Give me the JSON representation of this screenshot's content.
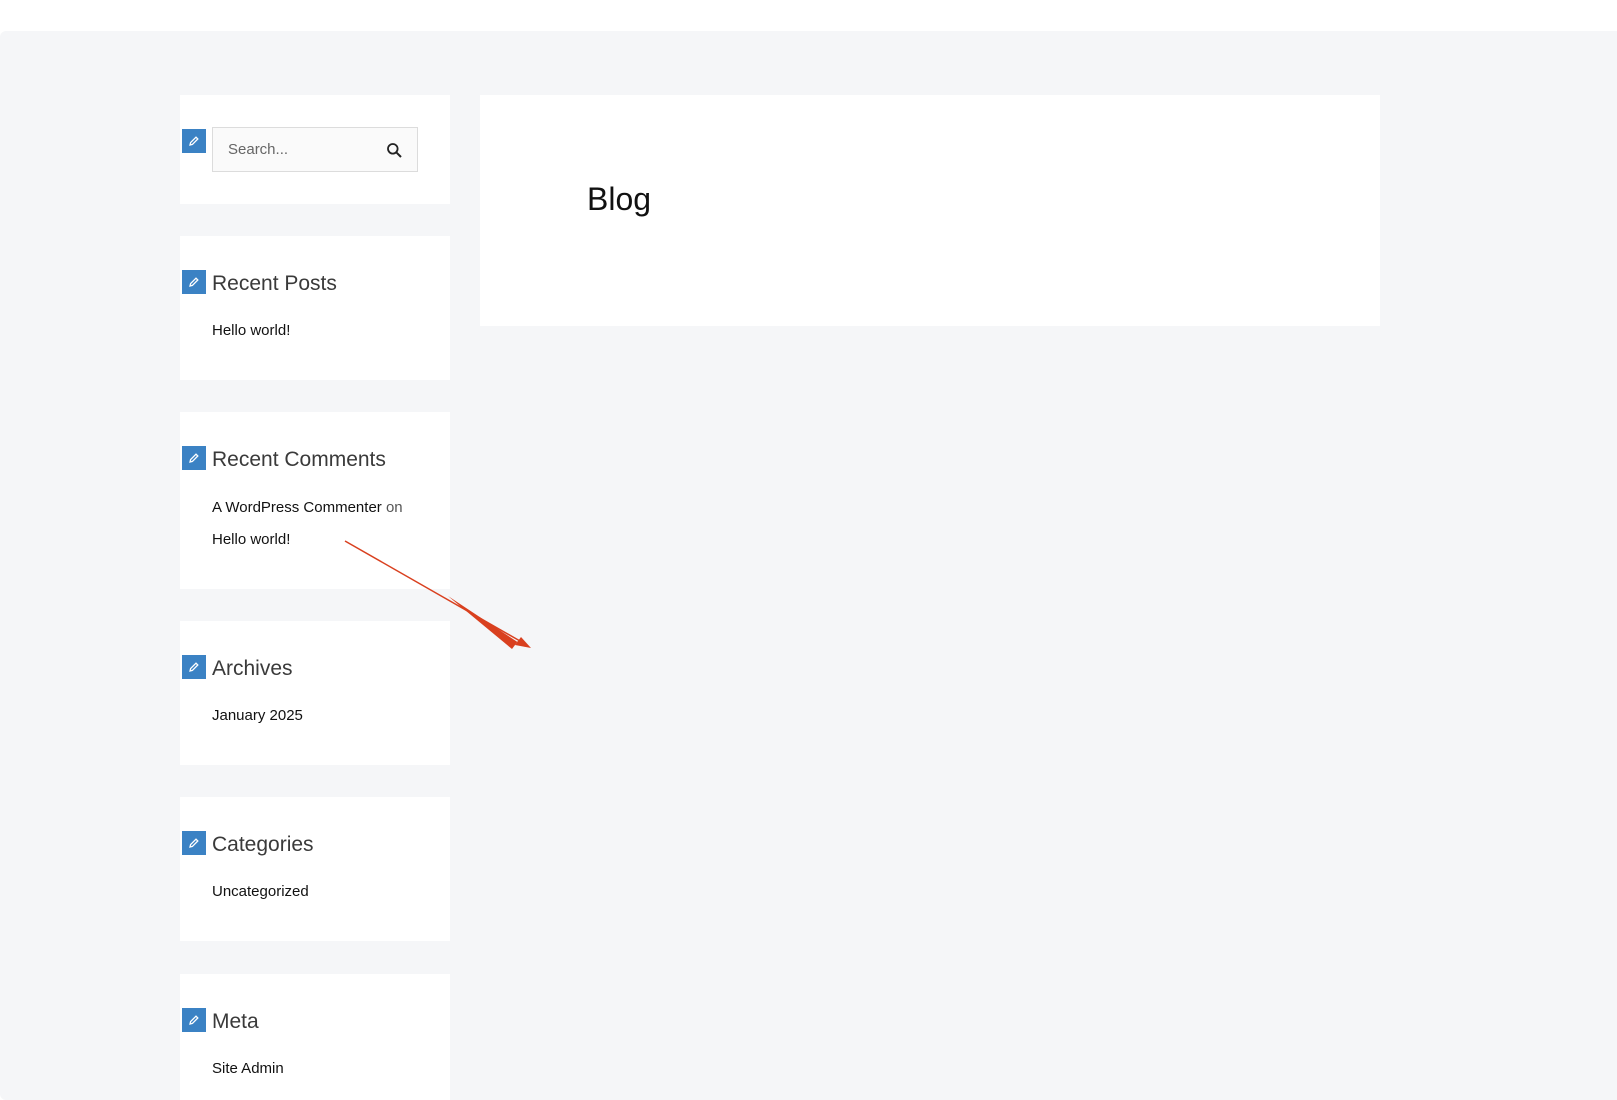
{
  "search": {
    "placeholder": "Search..."
  },
  "widgets": {
    "recent_posts": {
      "title": "Recent Posts",
      "items": [
        "Hello world!"
      ]
    },
    "recent_comments": {
      "title": "Recent Comments",
      "author": "A WordPress Commenter",
      "connector": "on",
      "post": "Hello world!"
    },
    "archives": {
      "title": "Archives",
      "items": [
        "January 2025"
      ]
    },
    "categories": {
      "title": "Categories",
      "items": [
        "Uncategorized"
      ]
    },
    "meta": {
      "title": "Meta",
      "items": [
        "Site Admin"
      ]
    }
  },
  "main": {
    "title": "Blog"
  },
  "colors": {
    "accent": "#3b82c4",
    "annotation": "#d9401f",
    "background": "#f5f6f8"
  },
  "icons": [
    "pencil-icon",
    "search-icon"
  ]
}
